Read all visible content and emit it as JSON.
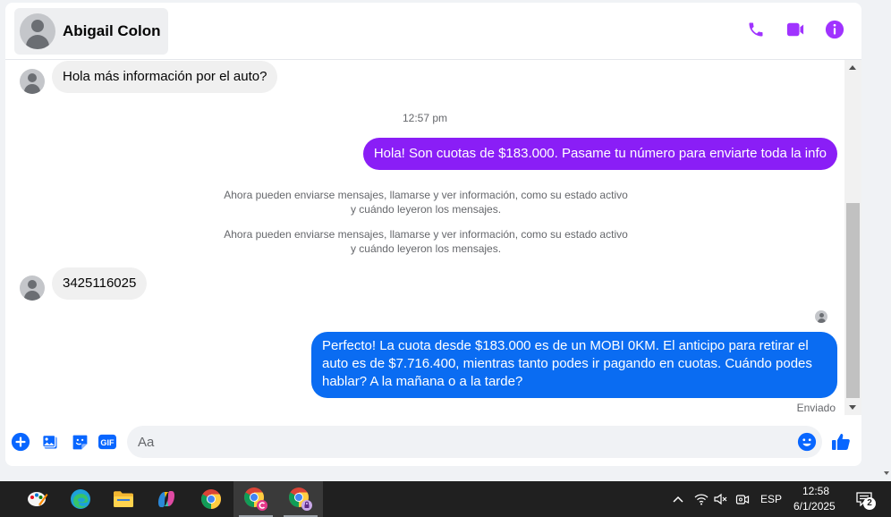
{
  "header": {
    "contact_name": "Abigail Colon",
    "actions": [
      "phone-icon",
      "video-icon",
      "info-icon"
    ],
    "accent_color": "#a033ff"
  },
  "messages": [
    {
      "type": "incoming",
      "text": "Hola más información por el auto?"
    },
    {
      "type": "timestamp",
      "text": "12:57 pm"
    },
    {
      "type": "outgoing",
      "color": "#8a1ef6",
      "text": "Hola! Son cuotas de $183.000. Pasame tu número para enviarte toda la info"
    },
    {
      "type": "system",
      "text": "Ahora pueden enviarse mensajes, llamarse y ver información, como su estado activo y cuándo leyeron los mensajes."
    },
    {
      "type": "system",
      "text": "Ahora pueden enviarse mensajes, llamarse y ver información, como su estado activo y cuándo leyeron los mensajes."
    },
    {
      "type": "incoming",
      "text": "3425116025"
    },
    {
      "type": "outgoing",
      "color": "#0a6cf2",
      "lines": [
        "Perfecto! La cuota desde $183.000 es de un MOBI 0KM. El anticipo para retirar el",
        "auto es de $7.716.400, mientras tanto podes ir pagando en cuotas. Cuándo podes",
        "hablar? A la mañana o a la tarde?"
      ]
    },
    {
      "type": "status",
      "text": "Enviado"
    }
  ],
  "composer": {
    "placeholder": "Aa",
    "buttons": [
      "plus-icon",
      "photo-icon",
      "sticker-icon",
      "gif-icon"
    ],
    "gif_label": "GIF",
    "accent_color": "#0866ff"
  },
  "taskbar": {
    "apps": [
      "paint-app",
      "edge-browser",
      "file-explorer",
      "copilot",
      "chrome",
      "chrome-profile-c",
      "chrome-profile-locked"
    ],
    "language": "ESP",
    "time": "12:58",
    "date": "6/1/2025",
    "notification_count": "2"
  }
}
